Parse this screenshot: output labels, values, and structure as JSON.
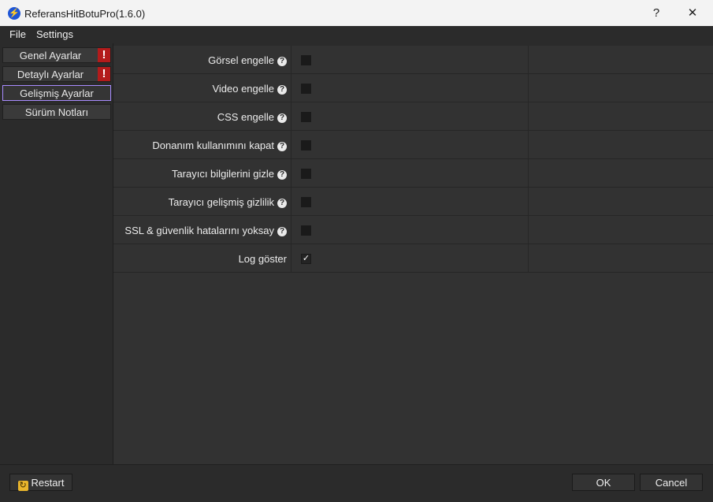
{
  "window": {
    "title": "ReferansHitBotuPro(1.6.0)",
    "help_label": "?",
    "close_label": "✕"
  },
  "menu": {
    "items": [
      "File",
      "Settings"
    ]
  },
  "sidebar": {
    "items": [
      {
        "label": "Genel Ayarlar",
        "alert": "!"
      },
      {
        "label": "Detaylı Ayarlar",
        "alert": "!"
      },
      {
        "label": "Gelişmiş Ayarlar",
        "alert": ""
      },
      {
        "label": "Sürüm Notları",
        "alert": ""
      }
    ],
    "active_index": 2
  },
  "settings": {
    "rows": [
      {
        "label": "Görsel engelle",
        "checked": false
      },
      {
        "label": "Video engelle",
        "checked": false
      },
      {
        "label": "CSS engelle",
        "checked": false
      },
      {
        "label": "Donanım kullanımını kapat",
        "checked": false
      },
      {
        "label": "Tarayıcı bilgilerini gizle",
        "checked": false
      },
      {
        "label": "Tarayıcı gelişmiş gizlilik",
        "checked": false
      },
      {
        "label": "SSL & güvenlik hatalarını yoksay",
        "checked": false
      },
      {
        "label": "Log göster",
        "checked": true
      }
    ],
    "help_glyph": "?",
    "check_glyph": "✓"
  },
  "footer": {
    "restart_label": "Restart",
    "ok_label": "OK",
    "cancel_label": "Cancel"
  }
}
